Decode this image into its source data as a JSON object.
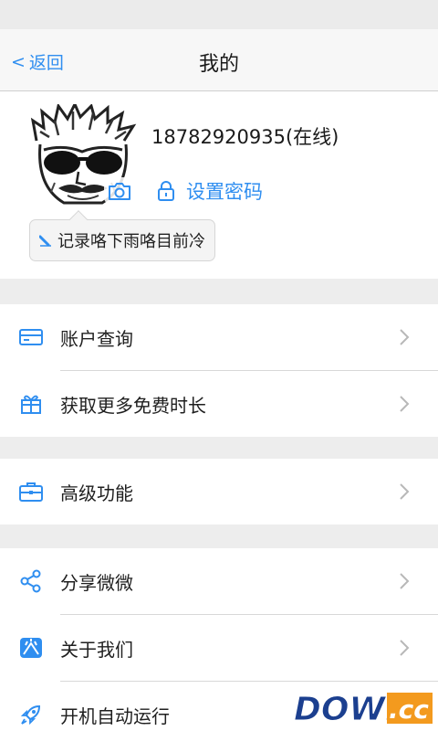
{
  "nav": {
    "back_label": "返回",
    "title": "我的"
  },
  "profile": {
    "phone_status": "18782920935(在线)",
    "set_password_label": "设置密码",
    "signature": "记录咯下雨咯目前冷"
  },
  "menu_groups": [
    {
      "items": [
        {
          "label": "账户查询",
          "icon": "card-icon"
        },
        {
          "label": "获取更多免费时长",
          "icon": "gift-icon"
        }
      ]
    },
    {
      "items": [
        {
          "label": "高级功能",
          "icon": "briefcase-icon"
        }
      ]
    },
    {
      "items": [
        {
          "label": "分享微微",
          "icon": "share-icon"
        },
        {
          "label": "关于我们",
          "icon": "about-icon"
        },
        {
          "label": "开机自动运行",
          "icon": "rocket-icon"
        }
      ]
    }
  ],
  "watermark": {
    "text_main": "DOWN",
    "text_suffix": ".cc"
  },
  "colors": {
    "accent": "#2f8ef0",
    "background": "#ededed",
    "divider": "#d8d8d8"
  }
}
